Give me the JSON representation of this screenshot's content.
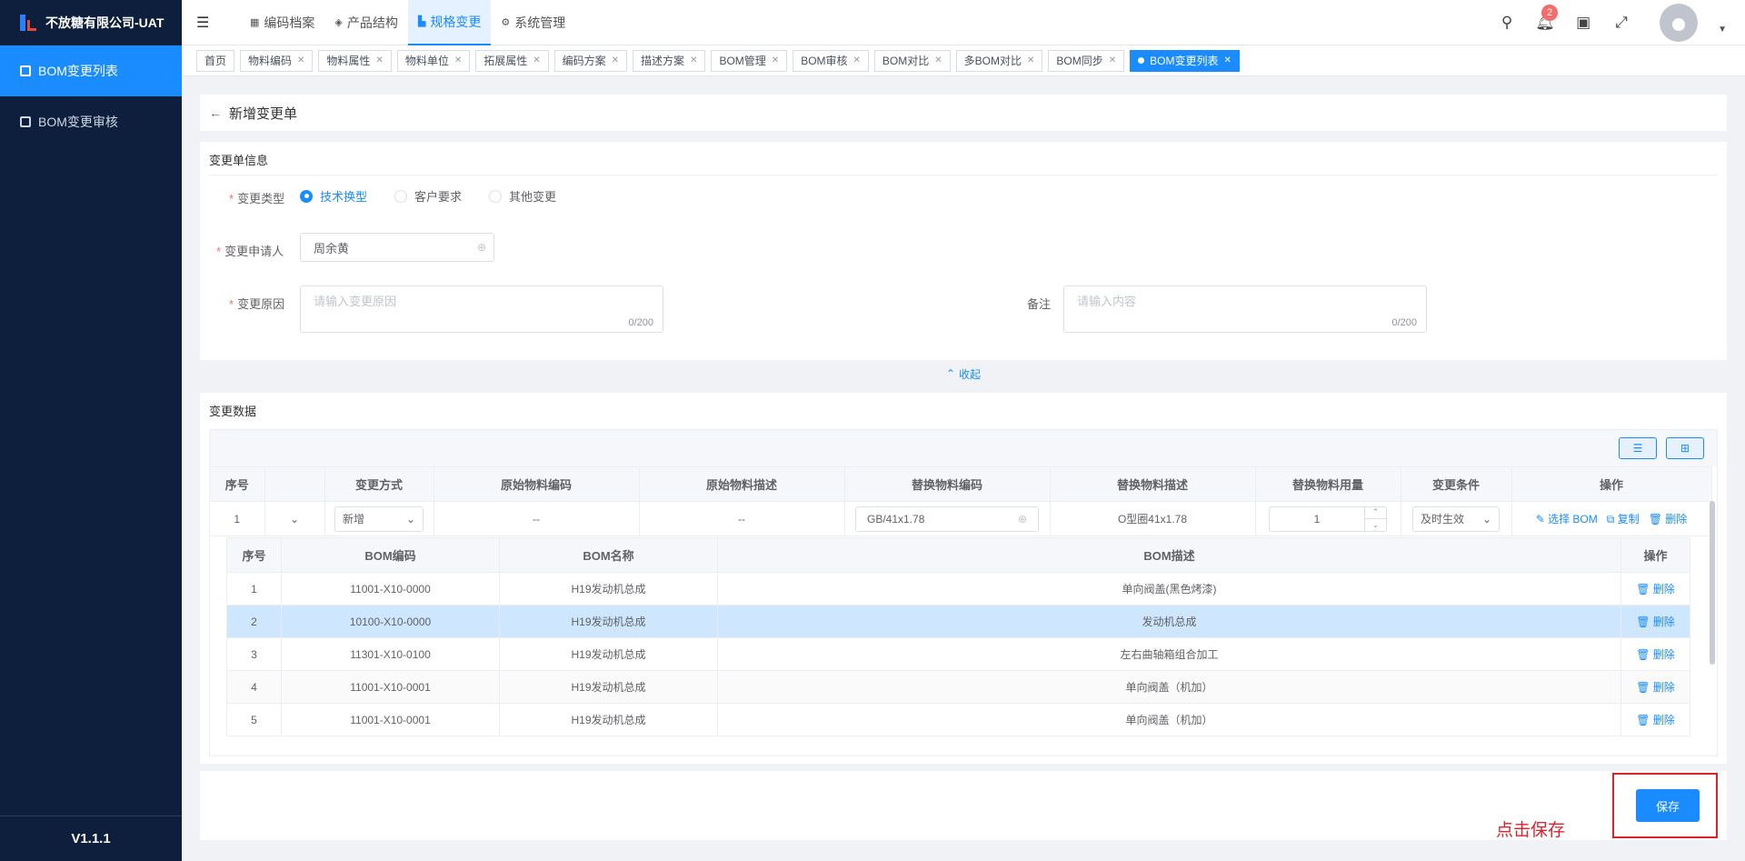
{
  "app": {
    "title": "不放糖有限公司-UAT",
    "version": "V1.1.1"
  },
  "sidebar": {
    "items": [
      {
        "label": "BOM变更列表",
        "active": true
      },
      {
        "label": "BOM变更审核",
        "active": false
      }
    ]
  },
  "topnav": {
    "items": [
      {
        "label": "编码档案",
        "icon": "archive-icon"
      },
      {
        "label": "产品结构",
        "icon": "layers-icon"
      },
      {
        "label": "规格变更",
        "icon": "spec-icon",
        "active": true
      },
      {
        "label": "系统管理",
        "icon": "gear-icon"
      }
    ],
    "notification_count": "2"
  },
  "tags": [
    {
      "label": "首页",
      "closable": false
    },
    {
      "label": "物料编码",
      "closable": true
    },
    {
      "label": "物料属性",
      "closable": true
    },
    {
      "label": "物料单位",
      "closable": true
    },
    {
      "label": "拓展属性",
      "closable": true
    },
    {
      "label": "编码方案",
      "closable": true
    },
    {
      "label": "描述方案",
      "closable": true
    },
    {
      "label": "BOM管理",
      "closable": true
    },
    {
      "label": "BOM审核",
      "closable": true
    },
    {
      "label": "BOM对比",
      "closable": true
    },
    {
      "label": "多BOM对比",
      "closable": true
    },
    {
      "label": "BOM同步",
      "closable": true
    },
    {
      "label": "BOM变更列表",
      "closable": true,
      "active": true
    }
  ],
  "page": {
    "title": "新增变更单"
  },
  "form": {
    "section_title": "变更单信息",
    "change_type": {
      "label": "变更类型",
      "options": [
        "技术换型",
        "客户要求",
        "其他变更"
      ],
      "selected": "技术换型"
    },
    "applicant": {
      "label": "变更申请人",
      "value": "周余黄"
    },
    "reason": {
      "label": "变更原因",
      "placeholder": "请输入变更原因",
      "count": "0/200"
    },
    "remark": {
      "label": "备注",
      "placeholder": "请输入内容",
      "count": "0/200"
    },
    "collapse_label": "收起"
  },
  "change_data": {
    "section_title": "变更数据",
    "columns": [
      "序号",
      "",
      "变更方式",
      "原始物料编码",
      "原始物料描述",
      "替换物料编码",
      "替换物料描述",
      "替换物料用量",
      "变更条件",
      "操作"
    ],
    "row": {
      "index": "1",
      "method": "新增",
      "orig_code": "--",
      "orig_desc": "--",
      "new_code": "GB/41x1.78",
      "new_desc": "O型圈41x1.78",
      "qty": "1",
      "condition": "及时生效",
      "ops": [
        "选择 BOM",
        "复制",
        "删除"
      ]
    },
    "bom_columns": [
      "序号",
      "BOM编码",
      "BOM名称",
      "BOM描述",
      "操作"
    ],
    "bom_rows": [
      {
        "index": "1",
        "code": "11001-X10-0000",
        "name": "H19发动机总成",
        "desc": "单向阀盖(黑色烤漆)",
        "op": "删除"
      },
      {
        "index": "2",
        "code": "10100-X10-0000",
        "name": "H19发动机总成",
        "desc": "发动机总成",
        "op": "删除",
        "highlight": true
      },
      {
        "index": "3",
        "code": "11301-X10-0100",
        "name": "H19发动机总成",
        "desc": "左右曲轴箱组合加工",
        "op": "删除"
      },
      {
        "index": "4",
        "code": "11001-X10-0001",
        "name": "H19发动机总成",
        "desc": "单向阀盖（机加）",
        "op": "删除"
      },
      {
        "index": "5",
        "code": "11001-X10-0001",
        "name": "H19发动机总成",
        "desc": "单向阀盖（机加）",
        "op": "删除"
      }
    ]
  },
  "footer": {
    "save_label": "保存",
    "annotation": "点击保存"
  },
  "colors": {
    "primary": "#1a8cff",
    "sidebar": "#0d1f3c",
    "annotation": "#e0202a"
  }
}
